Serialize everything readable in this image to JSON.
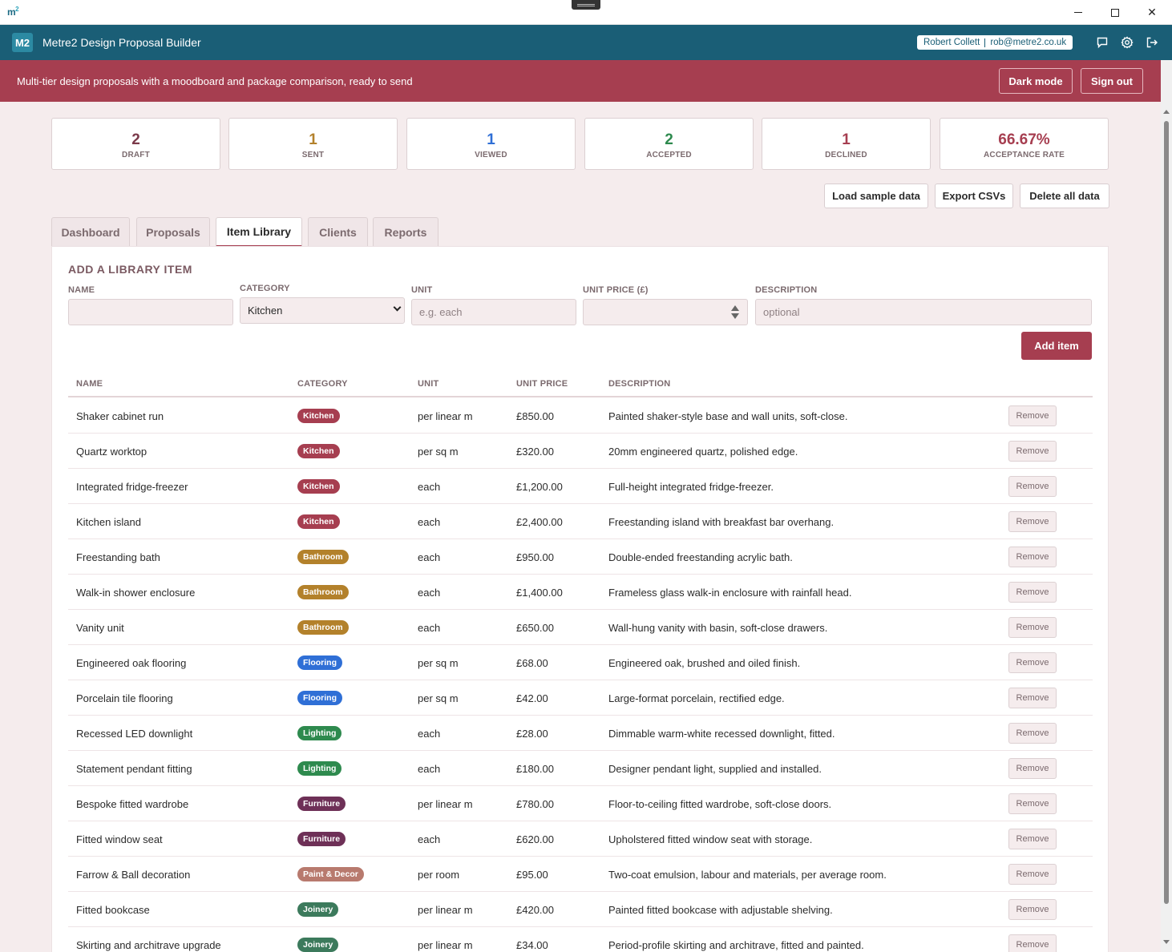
{
  "window": {
    "logo": "m",
    "logo_sup": "2"
  },
  "app": {
    "logo": "M2",
    "title": "Metre2 Design Proposal Builder",
    "user_name": "Robert Collett",
    "user_email": "rob@metre2.co.uk"
  },
  "banner": {
    "message": "Multi-tier design proposals with a moodboard and package comparison, ready to send",
    "dark_mode": "Dark mode",
    "sign_out": "Sign out"
  },
  "stats": [
    {
      "value": "2",
      "label": "DRAFT",
      "color": "#7b3a4a"
    },
    {
      "value": "1",
      "label": "SENT",
      "color": "#b3812b"
    },
    {
      "value": "1",
      "label": "VIEWED",
      "color": "#2f6fd6"
    },
    {
      "value": "2",
      "label": "ACCEPTED",
      "color": "#2e8a4e"
    },
    {
      "value": "1",
      "label": "DECLINED",
      "color": "#a63e50"
    },
    {
      "value": "66.67%",
      "label": "ACCEPTANCE RATE",
      "color": "#a63e50"
    }
  ],
  "toolbar": {
    "load_sample": "Load sample data",
    "export": "Export CSVs",
    "delete_all": "Delete all data"
  },
  "tabs": [
    "Dashboard",
    "Proposals",
    "Item Library",
    "Clients",
    "Reports"
  ],
  "active_tab": "Item Library",
  "form": {
    "title": "ADD A LIBRARY ITEM",
    "name_label": "NAME",
    "name_value": "",
    "category_label": "CATEGORY",
    "category_value": "Kitchen",
    "unit_label": "UNIT",
    "unit_placeholder": "e.g. each",
    "price_label": "UNIT PRICE (£)",
    "price_value": "",
    "description_label": "DESCRIPTION",
    "description_placeholder": "optional",
    "add_button": "Add item"
  },
  "table": {
    "headers": [
      "NAME",
      "CATEGORY",
      "UNIT",
      "UNIT PRICE",
      "DESCRIPTION"
    ],
    "remove_label": "Remove",
    "category_colors": {
      "Kitchen": "#a63e50",
      "Bathroom": "#b3812b",
      "Flooring": "#2f6fd6",
      "Lighting": "#2e8a4e",
      "Furniture": "#6e3057",
      "Paint & Decor": "#b87a6e",
      "Joinery": "#3c7a5c"
    },
    "rows": [
      {
        "name": "Shaker cabinet run",
        "category": "Kitchen",
        "unit": "per linear m",
        "price": "£850.00",
        "description": "Painted shaker-style base and wall units, soft-close."
      },
      {
        "name": "Quartz worktop",
        "category": "Kitchen",
        "unit": "per sq m",
        "price": "£320.00",
        "description": "20mm engineered quartz, polished edge."
      },
      {
        "name": "Integrated fridge-freezer",
        "category": "Kitchen",
        "unit": "each",
        "price": "£1,200.00",
        "description": "Full-height integrated fridge-freezer."
      },
      {
        "name": "Kitchen island",
        "category": "Kitchen",
        "unit": "each",
        "price": "£2,400.00",
        "description": "Freestanding island with breakfast bar overhang."
      },
      {
        "name": "Freestanding bath",
        "category": "Bathroom",
        "unit": "each",
        "price": "£950.00",
        "description": "Double-ended freestanding acrylic bath."
      },
      {
        "name": "Walk-in shower enclosure",
        "category": "Bathroom",
        "unit": "each",
        "price": "£1,400.00",
        "description": "Frameless glass walk-in enclosure with rainfall head."
      },
      {
        "name": "Vanity unit",
        "category": "Bathroom",
        "unit": "each",
        "price": "£650.00",
        "description": "Wall-hung vanity with basin, soft-close drawers."
      },
      {
        "name": "Engineered oak flooring",
        "category": "Flooring",
        "unit": "per sq m",
        "price": "£68.00",
        "description": "Engineered oak, brushed and oiled finish."
      },
      {
        "name": "Porcelain tile flooring",
        "category": "Flooring",
        "unit": "per sq m",
        "price": "£42.00",
        "description": "Large-format porcelain, rectified edge."
      },
      {
        "name": "Recessed LED downlight",
        "category": "Lighting",
        "unit": "each",
        "price": "£28.00",
        "description": "Dimmable warm-white recessed downlight, fitted."
      },
      {
        "name": "Statement pendant fitting",
        "category": "Lighting",
        "unit": "each",
        "price": "£180.00",
        "description": "Designer pendant light, supplied and installed."
      },
      {
        "name": "Bespoke fitted wardrobe",
        "category": "Furniture",
        "unit": "per linear m",
        "price": "£780.00",
        "description": "Floor-to-ceiling fitted wardrobe, soft-close doors."
      },
      {
        "name": "Fitted window seat",
        "category": "Furniture",
        "unit": "each",
        "price": "£620.00",
        "description": "Upholstered fitted window seat with storage."
      },
      {
        "name": "Farrow & Ball decoration",
        "category": "Paint & Decor",
        "unit": "per room",
        "price": "£95.00",
        "description": "Two-coat emulsion, labour and materials, per average room."
      },
      {
        "name": "Fitted bookcase",
        "category": "Joinery",
        "unit": "per linear m",
        "price": "£420.00",
        "description": "Painted fitted bookcase with adjustable shelving."
      },
      {
        "name": "Skirting and architrave upgrade",
        "category": "Joinery",
        "unit": "per linear m",
        "price": "£34.00",
        "description": "Period-profile skirting and architrave, fitted and painted."
      }
    ]
  }
}
